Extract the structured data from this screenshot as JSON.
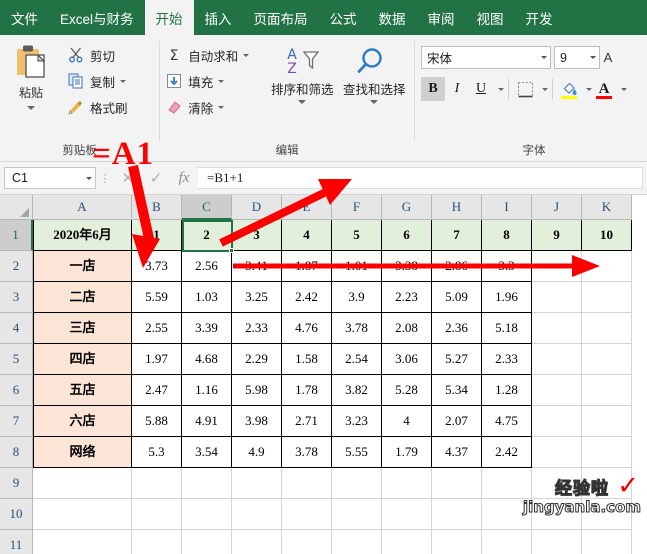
{
  "ribbon": {
    "tabs": [
      {
        "label": "文件",
        "active": false
      },
      {
        "label": "Excel与财务",
        "active": false
      },
      {
        "label": "开始",
        "active": true
      },
      {
        "label": "插入",
        "active": false
      },
      {
        "label": "页面布局",
        "active": false
      },
      {
        "label": "公式",
        "active": false
      },
      {
        "label": "数据",
        "active": false
      },
      {
        "label": "审阅",
        "active": false
      },
      {
        "label": "视图",
        "active": false
      },
      {
        "label": "开发",
        "active": false
      }
    ],
    "clipboard": {
      "title": "剪贴板",
      "paste_label": "粘贴",
      "cut_label": "剪切",
      "copy_label": "复制",
      "format_painter_label": "格式刷"
    },
    "editing": {
      "title": "编辑",
      "autosum_label": "自动求和",
      "fill_label": "填充",
      "clear_label": "清除",
      "sort_filter_label": "排序和筛选",
      "find_select_label": "查找和选择"
    },
    "font": {
      "title": "字体",
      "font_name": "宋体",
      "font_size": "9",
      "bold_label": "B",
      "italic_label": "I",
      "underline_label": "U",
      "fill_color": "#ffff00",
      "font_color": "#ff0000"
    }
  },
  "formula_bar": {
    "name_box_value": "C1",
    "cancel_icon": "✕",
    "confirm_icon": "✓",
    "fx_label": "fx",
    "formula_value": "=B1+1"
  },
  "grid": {
    "columns": [
      "A",
      "B",
      "C",
      "D",
      "E",
      "F",
      "G",
      "H",
      "I",
      "J",
      "K"
    ],
    "selected_column": "C",
    "rows": [
      "1",
      "2",
      "3",
      "4",
      "5",
      "6",
      "7",
      "8",
      "9",
      "10",
      "11"
    ],
    "selected_row": "1",
    "data": [
      [
        "2020年6月",
        "1",
        "2",
        "3",
        "4",
        "5",
        "6",
        "7",
        "8",
        "9",
        "10"
      ],
      [
        "一店",
        "3.73",
        "2.56",
        "3.41",
        "1.87",
        "1.01",
        "3.38",
        "2.86",
        "3.3",
        "",
        ""
      ],
      [
        "二店",
        "5.59",
        "1.03",
        "3.25",
        "2.42",
        "3.9",
        "2.23",
        "5.09",
        "1.96",
        "",
        ""
      ],
      [
        "三店",
        "2.55",
        "3.39",
        "2.33",
        "4.76",
        "3.78",
        "2.08",
        "2.36",
        "5.18",
        "",
        ""
      ],
      [
        "四店",
        "1.97",
        "4.68",
        "2.29",
        "1.58",
        "2.54",
        "3.06",
        "5.27",
        "2.33",
        "",
        ""
      ],
      [
        "五店",
        "2.47",
        "1.16",
        "5.98",
        "1.78",
        "3.82",
        "5.28",
        "5.34",
        "1.28",
        "",
        ""
      ],
      [
        "六店",
        "5.88",
        "4.91",
        "3.98",
        "2.71",
        "3.23",
        "4",
        "2.07",
        "4.75",
        "",
        ""
      ],
      [
        "网络",
        "5.3",
        "3.54",
        "4.9",
        "3.78",
        "5.55",
        "1.79",
        "4.37",
        "2.42",
        "",
        ""
      ],
      [
        "",
        "",
        "",
        "",
        "",
        "",
        "",
        "",
        "",
        "",
        ""
      ],
      [
        "",
        "",
        "",
        "",
        "",
        "",
        "",
        "",
        "",
        "",
        ""
      ],
      [
        "",
        "",
        "",
        "",
        "",
        "",
        "",
        "",
        "",
        "",
        ""
      ]
    ]
  },
  "annotations": {
    "formula_text": "=A1",
    "arrow_down_to_b1": "arrow-down",
    "arrow_up_to_formula_bar": "arrow-up-right",
    "arrow_right_across_row": "arrow-right"
  },
  "watermark": {
    "line1": "经验啦",
    "line2": "jingyanla.com",
    "check": "✓"
  },
  "colors": {
    "brand_green": "#217346",
    "header_fill": "#e2efda",
    "label_fill": "#fce4d6",
    "annotation_red": "#ff0000"
  }
}
